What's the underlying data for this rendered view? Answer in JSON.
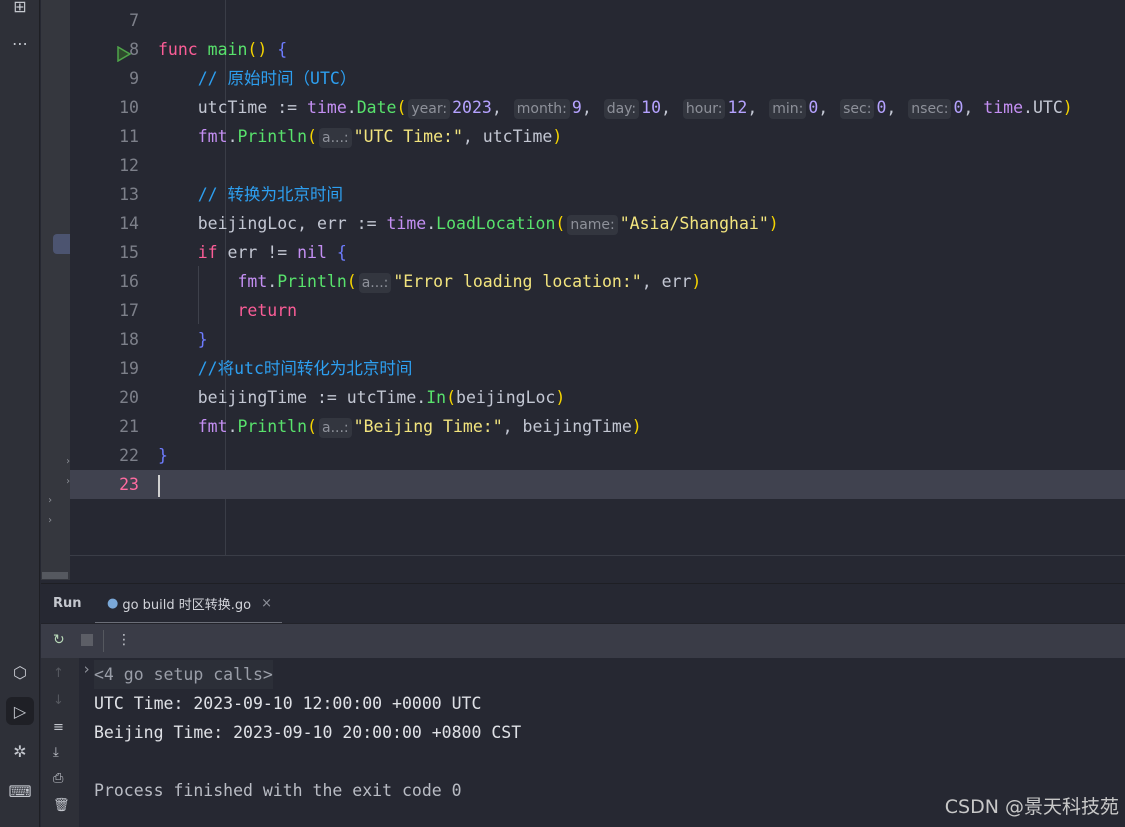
{
  "editor": {
    "lines": [
      {
        "n": "7",
        "tokens": []
      },
      {
        "n": "8",
        "run": true,
        "tokens": [
          [
            "func ",
            "kw"
          ],
          [
            "main",
            "fn"
          ],
          [
            "()",
            "paren"
          ],
          [
            " ",
            "plain"
          ],
          [
            "{",
            "brace"
          ]
        ]
      },
      {
        "n": "9",
        "tokens": [
          [
            "    // 原始时间（UTC）",
            "cm"
          ]
        ]
      },
      {
        "n": "10",
        "tokens": [
          [
            "    utcTime := ",
            "plain"
          ],
          [
            "time",
            "pkg"
          ],
          [
            ".",
            "plain"
          ],
          [
            "Date",
            "fn"
          ],
          [
            "(",
            "paren"
          ],
          [
            "year:",
            "hint"
          ],
          [
            "2023",
            "num"
          ],
          [
            ", ",
            "plain"
          ],
          [
            "month:",
            "hint"
          ],
          [
            "9",
            "num"
          ],
          [
            ", ",
            "plain"
          ],
          [
            "day:",
            "hint"
          ],
          [
            "10",
            "num"
          ],
          [
            ", ",
            "plain"
          ],
          [
            "hour:",
            "hint"
          ],
          [
            "12",
            "num"
          ],
          [
            ", ",
            "plain"
          ],
          [
            "min:",
            "hint"
          ],
          [
            "0",
            "num"
          ],
          [
            ", ",
            "plain"
          ],
          [
            "sec:",
            "hint"
          ],
          [
            "0",
            "num"
          ],
          [
            ", ",
            "plain"
          ],
          [
            "nsec:",
            "hint"
          ],
          [
            "0",
            "num"
          ],
          [
            ", ",
            "plain"
          ],
          [
            "time",
            "pkg"
          ],
          [
            ".UTC",
            "plain"
          ],
          [
            ")",
            "paren"
          ]
        ]
      },
      {
        "n": "11",
        "tokens": [
          [
            "    ",
            "plain"
          ],
          [
            "fmt",
            "pkg"
          ],
          [
            ".",
            "plain"
          ],
          [
            "Println",
            "fn"
          ],
          [
            "(",
            "paren"
          ],
          [
            "a...:",
            "hint"
          ],
          [
            "\"UTC Time:\"",
            "str"
          ],
          [
            ", utcTime",
            "plain"
          ],
          [
            ")",
            "paren"
          ]
        ]
      },
      {
        "n": "12",
        "tokens": []
      },
      {
        "n": "13",
        "tokens": [
          [
            "    // 转换为北京时间",
            "cm"
          ]
        ]
      },
      {
        "n": "14",
        "tokens": [
          [
            "    beijingLoc, err := ",
            "plain"
          ],
          [
            "time",
            "pkg"
          ],
          [
            ".",
            "plain"
          ],
          [
            "LoadLocation",
            "fn"
          ],
          [
            "(",
            "paren"
          ],
          [
            "name:",
            "hint"
          ],
          [
            "\"Asia/Shanghai\"",
            "str"
          ],
          [
            ")",
            "paren"
          ]
        ]
      },
      {
        "n": "15",
        "tokens": [
          [
            "    ",
            "plain"
          ],
          [
            "if",
            "kw"
          ],
          [
            " err != ",
            "plain"
          ],
          [
            "nil",
            "pkg"
          ],
          [
            " ",
            "plain"
          ],
          [
            "{",
            "brace"
          ]
        ]
      },
      {
        "n": "16",
        "tokens": [
          [
            "        ",
            "plain"
          ],
          [
            "fmt",
            "pkg"
          ],
          [
            ".",
            "plain"
          ],
          [
            "Println",
            "fn"
          ],
          [
            "(",
            "paren"
          ],
          [
            "a...:",
            "hint"
          ],
          [
            "\"Error loading location:\"",
            "str"
          ],
          [
            ", err",
            "plain"
          ],
          [
            ")",
            "paren"
          ]
        ]
      },
      {
        "n": "17",
        "tokens": [
          [
            "        ",
            "plain"
          ],
          [
            "return",
            "kw"
          ]
        ]
      },
      {
        "n": "18",
        "tokens": [
          [
            "    ",
            "plain"
          ],
          [
            "}",
            "brace"
          ]
        ]
      },
      {
        "n": "19",
        "tokens": [
          [
            "    //将utc时间转化为北京时间",
            "cm"
          ]
        ]
      },
      {
        "n": "20",
        "tokens": [
          [
            "    beijingTime := utcTime.",
            "plain"
          ],
          [
            "In",
            "fn"
          ],
          [
            "(",
            "paren"
          ],
          [
            "beijingLoc",
            "plain"
          ],
          [
            ")",
            "paren"
          ]
        ]
      },
      {
        "n": "21",
        "tokens": [
          [
            "    ",
            "plain"
          ],
          [
            "fmt",
            "pkg"
          ],
          [
            ".",
            "plain"
          ],
          [
            "Println",
            "fn"
          ],
          [
            "(",
            "paren"
          ],
          [
            "a...:",
            "hint"
          ],
          [
            "\"Beijing Time:\"",
            "str"
          ],
          [
            ", beijingTime",
            "plain"
          ],
          [
            ")",
            "paren"
          ]
        ]
      },
      {
        "n": "22",
        "tokens": [
          [
            "}",
            "brace"
          ]
        ]
      },
      {
        "n": "23",
        "current": true,
        "tokens": []
      }
    ]
  },
  "run_panel": {
    "title": "Run",
    "tab_label": "go build 时区转换.go",
    "close": "×",
    "setup_calls": "<4 go setup calls>",
    "output": [
      "UTC Time: 2023-09-10 12:00:00 +0000 UTC",
      "Beijing Time: 2023-09-10 20:00:00 +0800 CST",
      "",
      "Process finished with the exit code 0"
    ]
  },
  "watermark": "CSDN @景天科技苑"
}
